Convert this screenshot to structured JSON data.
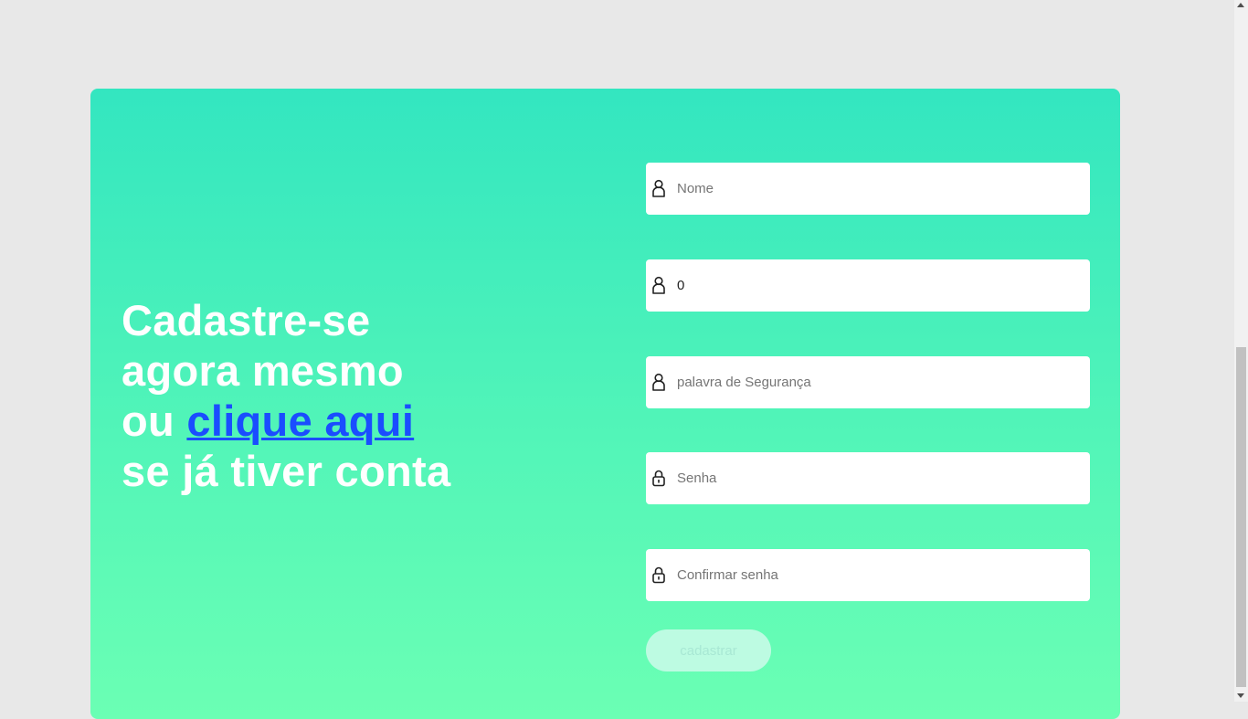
{
  "headline": {
    "line1": "Cadastre-se",
    "line2": "agora mesmo",
    "line3_prefix": "ou ",
    "link": "clique aqui",
    "line4": "se já tiver conta"
  },
  "form": {
    "name": {
      "placeholder": "Nome",
      "value": "",
      "icon": "user-icon"
    },
    "second": {
      "placeholder": "",
      "value": "0",
      "icon": "user-icon"
    },
    "security_word": {
      "placeholder": "palavra de Segurança",
      "value": "",
      "icon": "user-icon"
    },
    "password": {
      "placeholder": "Senha",
      "value": "",
      "icon": "lock-icon"
    },
    "confirm_password": {
      "placeholder": "Confirmar senha",
      "value": "",
      "icon": "lock-icon"
    },
    "submit_label": "cadastrar"
  },
  "colors": {
    "page_background": "#e8e8e8",
    "card_gradient_top": "#33e6c0",
    "card_gradient_bottom": "#6bffb4",
    "link": "#1a4dff",
    "submit_disabled_bg": "#bdfbe2"
  }
}
